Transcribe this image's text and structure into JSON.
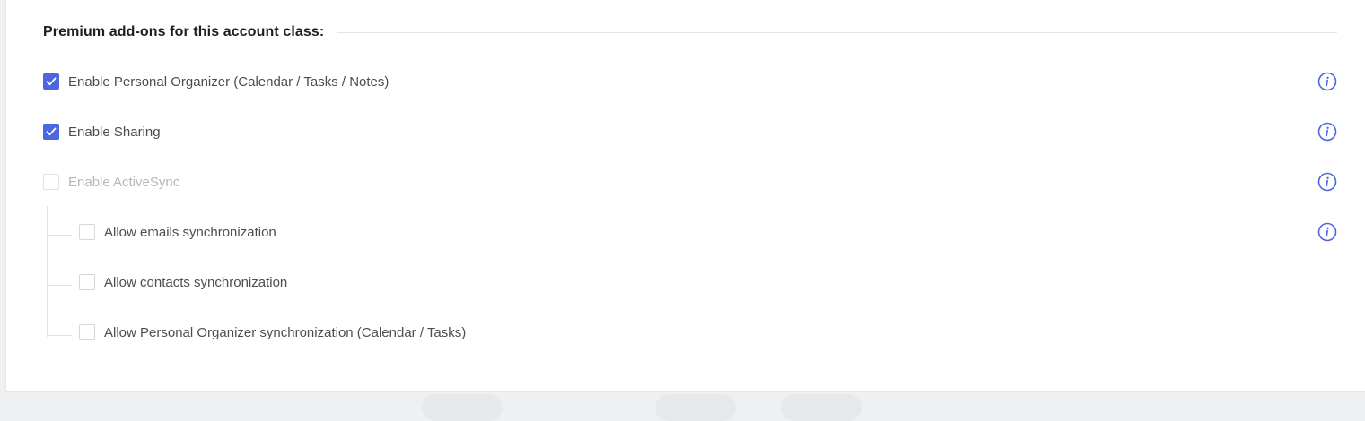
{
  "section": {
    "title": "Premium add-ons for this account class:"
  },
  "options": [
    {
      "label": "Enable Personal Organizer (Calendar / Tasks / Notes)",
      "checked": true,
      "disabled": false,
      "info": true
    },
    {
      "label": "Enable Sharing",
      "checked": true,
      "disabled": false,
      "info": true
    },
    {
      "label": "Enable ActiveSync",
      "checked": false,
      "disabled": true,
      "info": true
    }
  ],
  "sub_options": [
    {
      "label": "Allow emails synchronization",
      "checked": false,
      "info": true
    },
    {
      "label": "Allow contacts synchronization",
      "checked": false,
      "info": false
    },
    {
      "label": "Allow Personal Organizer synchronization (Calendar / Tasks)",
      "checked": false,
      "info": false
    }
  ],
  "colors": {
    "accent": "#4a66e0",
    "text": "#4a4d52",
    "disabled_text": "#b4b7bc",
    "info_icon": "#4a66e0"
  },
  "icons": {
    "check": "checkmark-icon",
    "info": "info-icon"
  }
}
